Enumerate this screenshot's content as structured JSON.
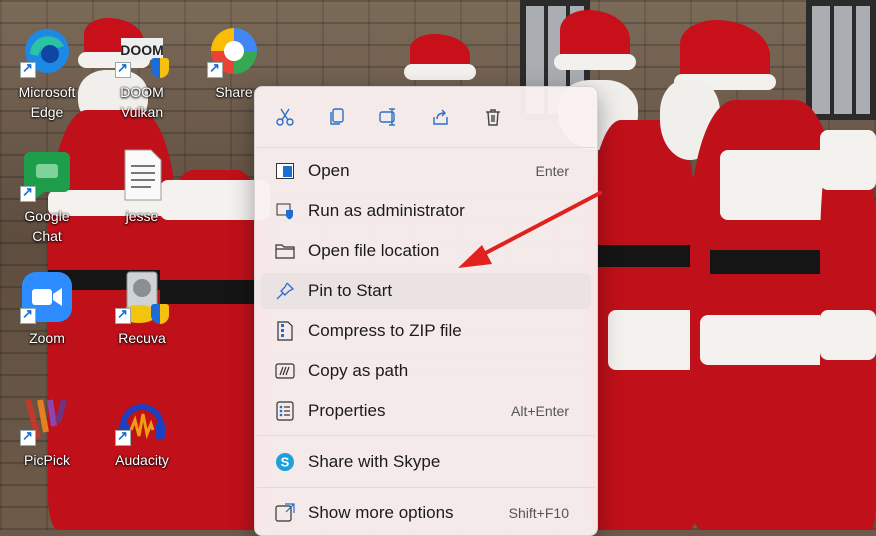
{
  "desktop": {
    "icons": [
      {
        "label": "Microsoft\nEdge",
        "icon": "edge-icon"
      },
      {
        "label": "DOOM\nVulkan",
        "icon": "doom-icon"
      },
      {
        "label": "Share",
        "icon": "share-app-icon"
      },
      {
        "label": "Google Chat",
        "icon": "google-chat-icon"
      },
      {
        "label": "jesse",
        "icon": "text-file-icon"
      },
      {
        "label": "Zoom",
        "icon": "zoom-icon"
      },
      {
        "label": "Recuva",
        "icon": "recuva-icon"
      },
      {
        "label": "PicPick",
        "icon": "picpick-icon"
      },
      {
        "label": "Audacity",
        "icon": "audacity-icon"
      }
    ]
  },
  "context_menu": {
    "quick_actions": [
      {
        "name": "cut",
        "icon": "scissors-icon"
      },
      {
        "name": "copy",
        "icon": "copy-icon"
      },
      {
        "name": "rename",
        "icon": "rename-icon"
      },
      {
        "name": "share",
        "icon": "share-icon"
      },
      {
        "name": "delete",
        "icon": "trash-icon"
      }
    ],
    "items": [
      {
        "label": "Open",
        "shortcut": "Enter",
        "icon": "open-app-icon"
      },
      {
        "label": "Run as administrator",
        "shortcut": "",
        "icon": "admin-shield-icon"
      },
      {
        "label": "Open file location",
        "shortcut": "",
        "icon": "folder-icon"
      },
      {
        "label": "Pin to Start",
        "shortcut": "",
        "icon": "pin-icon"
      },
      {
        "label": "Compress to ZIP file",
        "shortcut": "",
        "icon": "zip-icon"
      },
      {
        "label": "Copy as path",
        "shortcut": "",
        "icon": "copy-path-icon"
      },
      {
        "label": "Properties",
        "shortcut": "Alt+Enter",
        "icon": "properties-icon"
      },
      {
        "label": "Share with Skype",
        "shortcut": "",
        "icon": "skype-icon"
      },
      {
        "label": "Show more options",
        "shortcut": "Shift+F10",
        "icon": "more-options-icon"
      }
    ]
  },
  "colors": {
    "annotation_arrow": "#e0211d",
    "accent": "#1a6fd1"
  }
}
